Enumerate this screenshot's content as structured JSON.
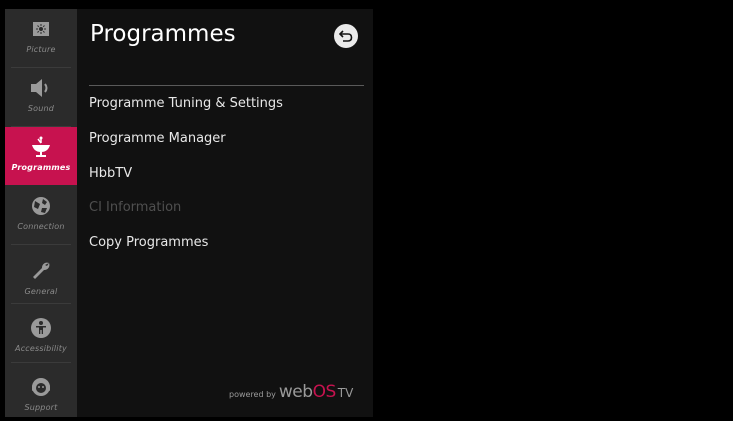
{
  "sidebar": {
    "items": [
      {
        "label": "Picture",
        "icon": "picture-icon",
        "active": false
      },
      {
        "label": "Sound",
        "icon": "speaker-icon",
        "active": false
      },
      {
        "label": "Programmes",
        "icon": "satellite-dish-icon",
        "active": true
      },
      {
        "label": "Connection",
        "icon": "globe-icon",
        "active": false
      },
      {
        "label": "General",
        "icon": "wrench-icon",
        "active": false
      },
      {
        "label": "Accessibility",
        "icon": "accessibility-icon",
        "active": false
      },
      {
        "label": "Support",
        "icon": "support-icon",
        "active": false
      }
    ]
  },
  "panel": {
    "title": "Programmes",
    "menu": [
      {
        "label": "Programme Tuning & Settings",
        "enabled": true
      },
      {
        "label": "Programme Manager",
        "enabled": true
      },
      {
        "label": "HbbTV",
        "enabled": true
      },
      {
        "label": "CI Information",
        "enabled": false
      },
      {
        "label": "Copy Programmes",
        "enabled": true
      }
    ]
  },
  "footer": {
    "powered_by": "powered by",
    "brand_web": "web",
    "brand_os": "OS",
    "brand_tv": "TV"
  },
  "colors": {
    "accent": "#c7124f",
    "sidebar_bg": "#2b2b2b",
    "panel_bg": "#111111",
    "disabled_text": "#4f4f4f"
  }
}
